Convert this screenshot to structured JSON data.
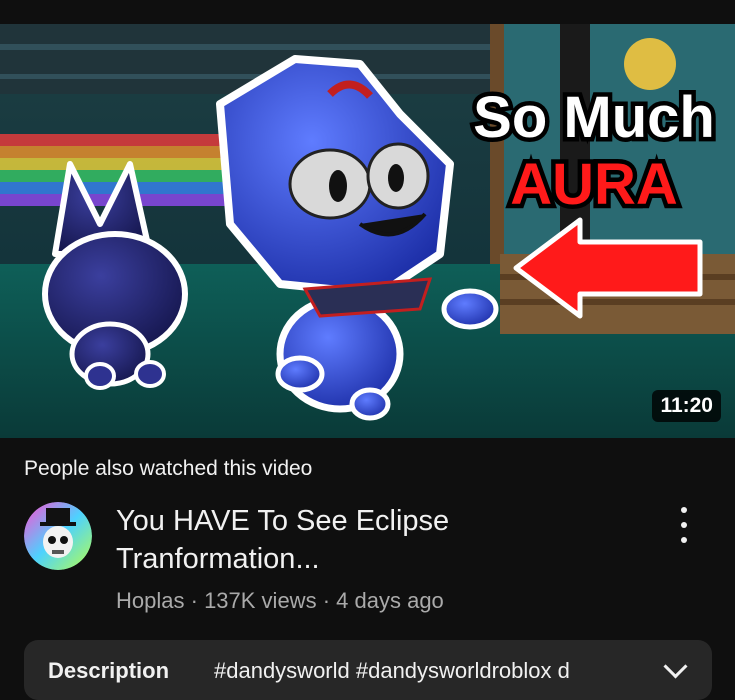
{
  "video": {
    "thumbnail_text_line1": "So Much",
    "thumbnail_text_line2": "AURA",
    "duration": "11:20"
  },
  "section": {
    "label": "People also watched this video"
  },
  "card": {
    "title": "You HAVE To See Eclipse Tranformation...",
    "channel": "Hoplas",
    "views": "137K views",
    "age": "4 days ago",
    "separator": "·"
  },
  "description": {
    "label": "Description",
    "tags": "#dandysworld #dandysworldroblox d"
  },
  "colors": {
    "background": "#0f0f0f",
    "text_primary": "#f1f1f1",
    "text_secondary": "#aaaaaa",
    "description_bg": "#272727",
    "arrow_red": "#ff1a1a"
  },
  "icons": {
    "more": "kebab-menu-icon",
    "expand": "chevron-down-icon"
  }
}
